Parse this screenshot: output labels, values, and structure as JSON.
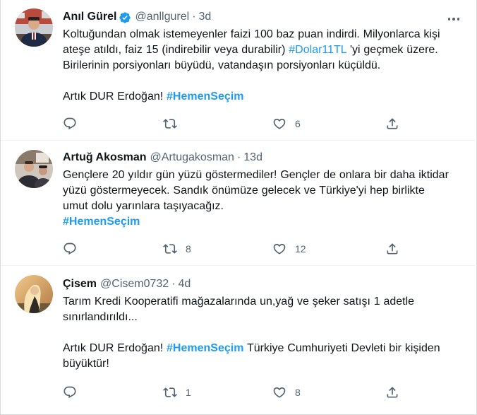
{
  "tweets": [
    {
      "name": "Anıl Gürel",
      "verified": true,
      "handle": "@anllgurel",
      "time": "3d",
      "lines": [
        [
          {
            "t": "Koltuğundan olmak istemeyenler faizi 100 baz puan indirdi. Milyonlarca kişi",
            "k": "plain"
          }
        ],
        [
          {
            "t": "ateşe atıldı, faiz 15 (indirebilir veya durabilir) ",
            "k": "plain"
          },
          {
            "t": "#Dolar11TL",
            "k": "link"
          },
          {
            "t": " 'yi geçmek üzere.",
            "k": "plain"
          }
        ],
        [
          {
            "t": "Birilerinin porsiyonları büyüdü, vatandaşın porsiyonları küçüldü.",
            "k": "plain"
          }
        ],
        [],
        [
          {
            "t": "Artık DUR Erdoğan! ",
            "k": "plain"
          },
          {
            "t": "#HemenSeçim",
            "k": "tag"
          }
        ]
      ],
      "replies": "",
      "retweets": "",
      "likes": "6"
    },
    {
      "name": "Artuğ Akosman",
      "verified": false,
      "handle": "@Artugakosman",
      "time": "13d",
      "lines": [
        [
          {
            "t": "Gençlere 20 yıldır gün yüzü göstermediler! Gençler de onlara bir daha iktidar",
            "k": "plain"
          }
        ],
        [
          {
            "t": "yüzü göstermeyecek. Sandık önümüze gelecek ve Türkiye'yi hep birlikte",
            "k": "plain"
          }
        ],
        [
          {
            "t": "umut dolu yarınlara taşıyacağız.",
            "k": "plain"
          }
        ],
        [
          {
            "t": "#HemenSeçim",
            "k": "tag"
          }
        ]
      ],
      "replies": "",
      "retweets": "8",
      "likes": "12"
    },
    {
      "name": "Çisem",
      "verified": false,
      "handle": "@Cisem0732",
      "time": "4d",
      "lines": [
        [
          {
            "t": "Tarım Kredi Kooperatifi mağazalarında un,yağ ve şeker satışı 1 adetle",
            "k": "plain"
          }
        ],
        [
          {
            "t": "sınırlandırıldı...",
            "k": "plain"
          }
        ],
        [],
        [
          {
            "t": "Artık DUR Erdoğan! ",
            "k": "plain"
          },
          {
            "t": "#HemenSeçim",
            "k": "tag"
          },
          {
            "t": " Türkiye Cumhuriyeti Devleti bir kişiden",
            "k": "plain"
          }
        ],
        [
          {
            "t": "büyüktür!",
            "k": "plain"
          }
        ]
      ],
      "replies": "",
      "retweets": "1",
      "likes": "8"
    }
  ],
  "icons": [
    "verified-badge-icon",
    "more-icon",
    "reply-icon",
    "retweet-icon",
    "like-icon",
    "share-icon"
  ],
  "colors": {
    "accent": "#1d9bf0",
    "muted": "#536471",
    "text": "#0f1419",
    "divider": "#eff3f4"
  }
}
